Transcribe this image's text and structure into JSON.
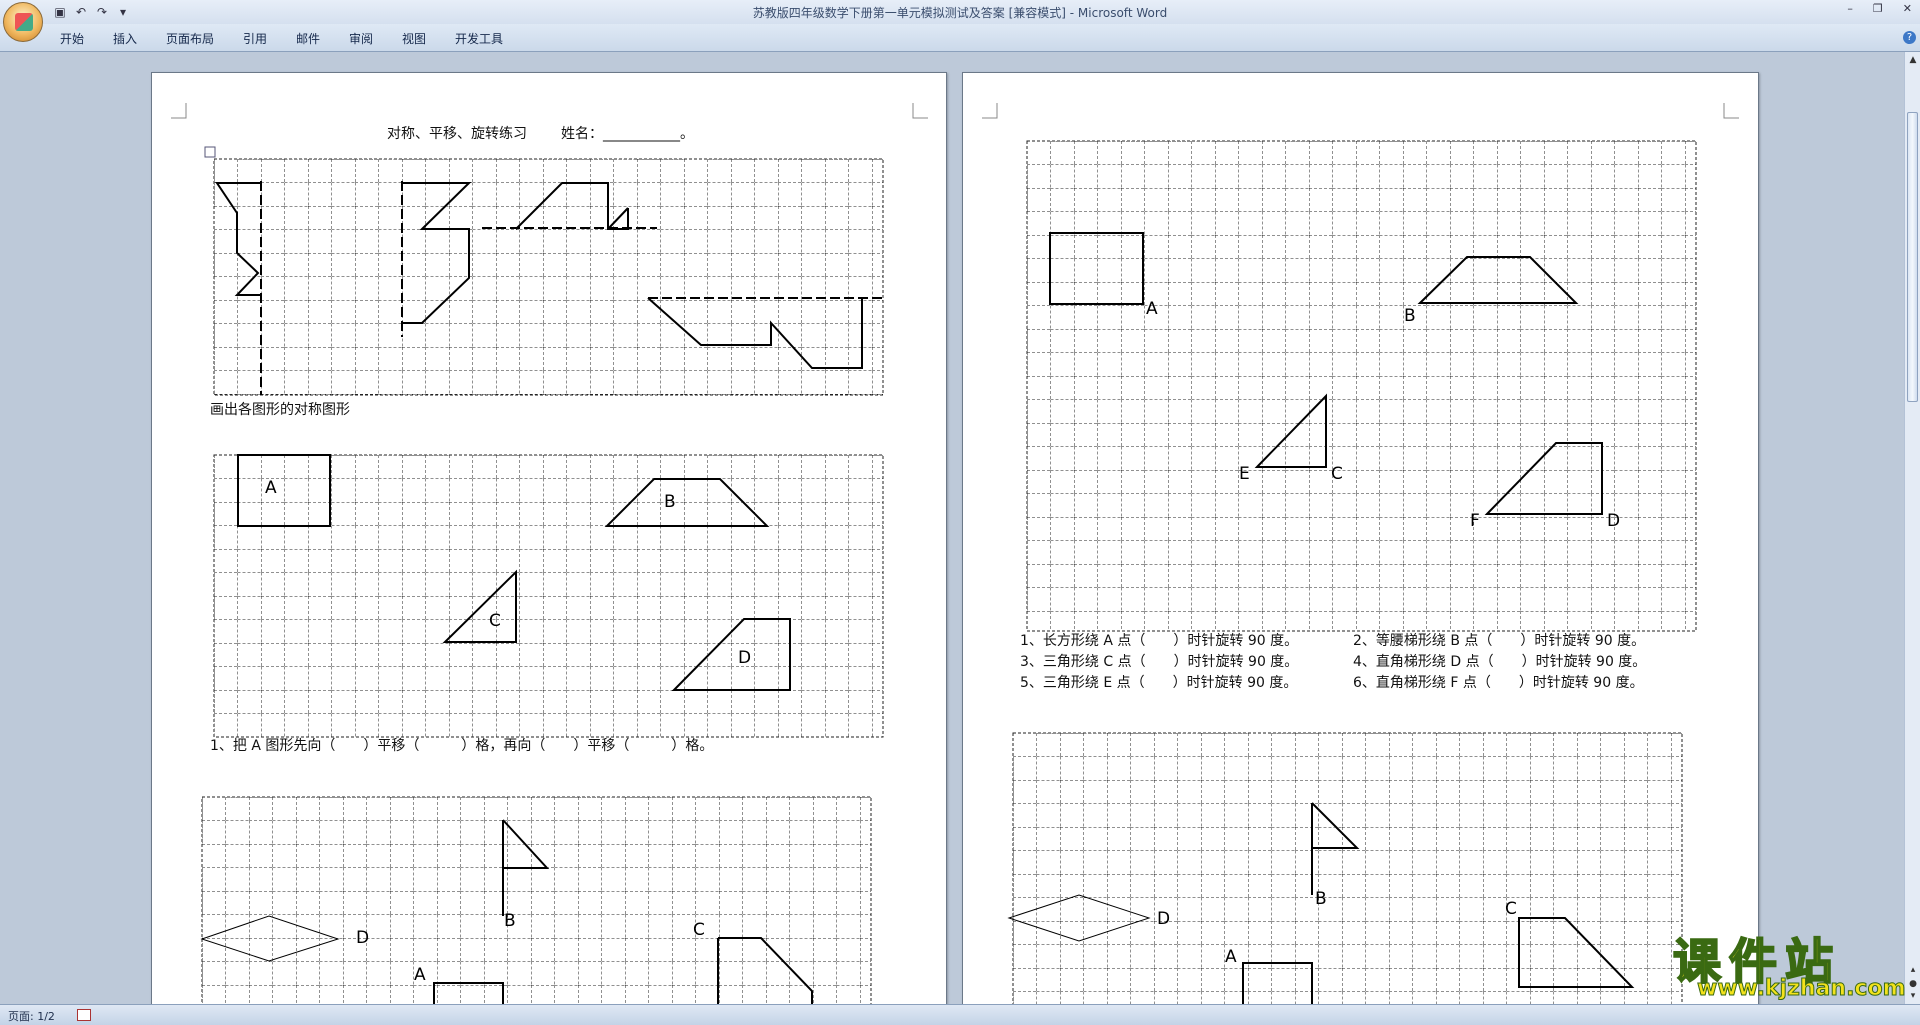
{
  "window": {
    "title": "苏教版四年级数学下册第一单元模拟测试及答案 [兼容模式] - Microsoft Word"
  },
  "ribbon": {
    "tabs": [
      "开始",
      "插入",
      "页面布局",
      "引用",
      "邮件",
      "审阅",
      "视图",
      "开发工具"
    ]
  },
  "page1": {
    "heading": "对称、平移、旋转练习",
    "name_label": "姓名：___________。",
    "instruction1": "画出各图形的对称图形",
    "labels": {
      "a": "A",
      "b": "B",
      "c": "C",
      "d": "D"
    },
    "question1": "1、把 A 图形先向（　　）平移（　　　）格，再向（　　）平移（　　　）格。",
    "bottom_labels": {
      "b": "B",
      "d": "D",
      "c": "C",
      "a": "A"
    }
  },
  "page2": {
    "labels": {
      "a": "A",
      "b": "B",
      "e": "E",
      "c": "C",
      "f": "F",
      "d": "D"
    },
    "questions": [
      "1、长方形绕 A 点（　　）时针旋转 90 度。",
      "2、等腰梯形绕 B 点（　　）时针旋转 90 度。",
      "3、三角形绕 C 点（　　）时针旋转 90 度。",
      "4、直角梯形绕 D 点（　　）时针旋转 90 度。",
      "5、三角形绕 E 点（　　）时针旋转 90 度。",
      "6、直角梯形绕 F 点（　　）时针旋转 90 度。"
    ],
    "bottom_labels": {
      "b": "B",
      "d": "D",
      "c": "C",
      "a": "A"
    }
  },
  "statusbar": {
    "page": "页面: 1/2"
  },
  "watermark": {
    "cn": "课件站",
    "url": "www.kjzhan.com"
  },
  "colors": {
    "ribbon": "#d5e0ef",
    "workspace": "#bdc9d9",
    "watermark": "#f3e21c"
  }
}
